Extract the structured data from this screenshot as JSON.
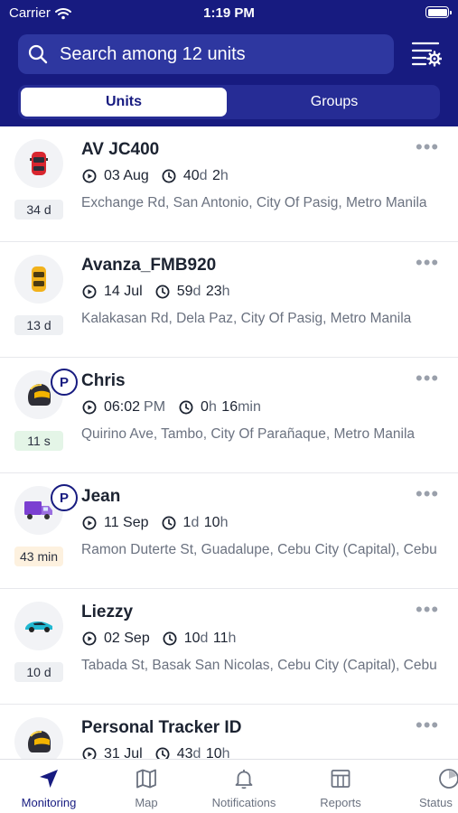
{
  "status_bar": {
    "carrier": "Carrier",
    "time": "1:19 PM"
  },
  "search": {
    "placeholder": "Search among 12 units"
  },
  "segments": {
    "units": "Units",
    "groups": "Groups"
  },
  "units": [
    {
      "name": "AV JC400",
      "last_msg": "03 Aug",
      "duration": [
        {
          "num": "40",
          "unit": "d "
        },
        {
          "num": "2",
          "unit": "h"
        }
      ],
      "address": "Exchange Rd, San Antonio, City Of Pasig, Metro Manila",
      "age": "34 d",
      "age_color": "gray",
      "icon": "red-car-icon",
      "parked": false
    },
    {
      "name": "Avanza_FMB920",
      "last_msg": "14 Jul",
      "duration": [
        {
          "num": "59",
          "unit": "d "
        },
        {
          "num": "23",
          "unit": "h"
        }
      ],
      "address": "Kalakasan Rd, Dela Paz, City Of Pasig, Metro Manila",
      "age": "13 d",
      "age_color": "gray",
      "icon": "yellow-car-icon",
      "parked": false
    },
    {
      "name": "Chris",
      "last_msg": "06:02",
      "last_msg_suffix": "PM",
      "duration": [
        {
          "num": "0",
          "unit": "h "
        },
        {
          "num": "16",
          "unit": "min"
        }
      ],
      "address": "Quirino Ave, Tambo, City Of Parañaque, Metro Manila",
      "age": "11 s",
      "age_color": "green",
      "icon": "helmet-icon",
      "parked": true,
      "parked_label": "P"
    },
    {
      "name": "Jean",
      "last_msg": "11 Sep",
      "duration": [
        {
          "num": "1",
          "unit": "d "
        },
        {
          "num": "10",
          "unit": "h"
        }
      ],
      "address": "Ramon Duterte St, Guadalupe, Cebu City (Capital), Cebu",
      "age": "43 min",
      "age_color": "orange",
      "icon": "truck-icon",
      "parked": true,
      "parked_label": "P"
    },
    {
      "name": "Liezzy",
      "last_msg": "02 Sep",
      "duration": [
        {
          "num": "10",
          "unit": "d "
        },
        {
          "num": "11",
          "unit": "h"
        }
      ],
      "address": "Tabada St, Basak San Nicolas, Cebu City (Capital), Cebu",
      "age": "10 d",
      "age_color": "gray",
      "icon": "cyan-sports-car-icon",
      "parked": false
    },
    {
      "name": "Personal Tracker ID",
      "last_msg": "31 Jul",
      "duration": [
        {
          "num": "43",
          "unit": "d "
        },
        {
          "num": "10",
          "unit": "h"
        }
      ],
      "address": "",
      "age": "",
      "age_color": "gray",
      "icon": "helmet-icon",
      "parked": false
    }
  ],
  "tabbar": [
    {
      "label": "Monitoring",
      "icon": "navigation-arrow-icon",
      "active": true
    },
    {
      "label": "Map",
      "icon": "map-icon",
      "active": false
    },
    {
      "label": "Notifications",
      "icon": "bell-icon",
      "active": false
    },
    {
      "label": "Reports",
      "icon": "report-table-icon",
      "active": false
    },
    {
      "label": "Status",
      "icon": "status-clock-icon",
      "active": false
    }
  ],
  "colors": {
    "primary": "#171b80",
    "search_bg": "#2e37a0",
    "age_green": "#e4f5e7",
    "age_orange": "#fdf1df",
    "age_gray": "#eef0f3"
  }
}
